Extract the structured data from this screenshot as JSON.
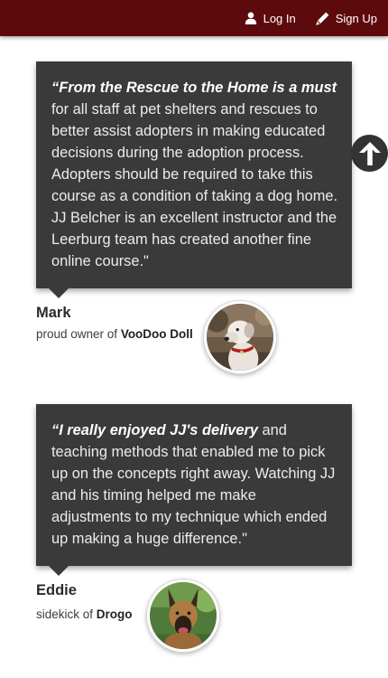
{
  "nav": {
    "login_label": "Log In",
    "signup_label": "Sign Up",
    "login_icon": "user-icon",
    "signup_icon": "pencil-icon"
  },
  "testimonials": [
    {
      "quote_lead": "“From the Rescue to the Home is a must",
      "quote_rest": " for all staff at pet shelters and rescues to better assist adopters in making educated decisions during the adoption process. Adopters should be required to take this course as a condition of taking a dog home. JJ Belcher is an excellent instructor and the Leerburg team has created another fine online course.\"",
      "name": "Mark",
      "desc_prefix": "proud owner of ",
      "pet": "VooDoo Doll"
    },
    {
      "quote_lead": "“I really enjoyed JJ's delivery",
      "quote_rest": " and teaching methods that enabled me to pick up on the concepts right away. Watching JJ and his timing helped me make adjustments to my technique which ended up making a huge difference.\"",
      "name": "Eddie",
      "desc_prefix": "sidekick of ",
      "pet": "Drogo"
    }
  ],
  "colors": {
    "topbar": "#5d0a0c",
    "bubble": "#3a3a3a"
  },
  "scroll_top_icon": "arrow-up-icon"
}
